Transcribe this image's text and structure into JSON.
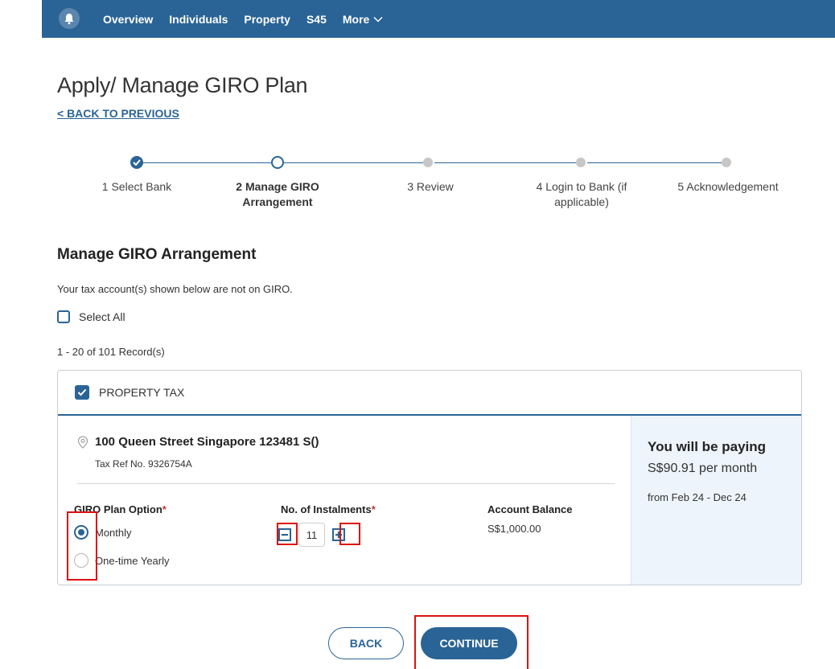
{
  "nav": {
    "items": [
      "Overview",
      "Individuals",
      "Property",
      "S45"
    ],
    "more_label": "More"
  },
  "page": {
    "title": "Apply/ Manage GIRO Plan",
    "back_link": "< BACK TO PREVIOUS"
  },
  "steps": [
    {
      "label": "1 Select Bank",
      "state": "done"
    },
    {
      "label": "2 Manage GIRO Arrangement",
      "state": "active"
    },
    {
      "label": "3 Review",
      "state": "pending"
    },
    {
      "label": "4 Login to Bank (if applicable)",
      "state": "pending"
    },
    {
      "label": "5 Acknowledgement",
      "state": "pending"
    }
  ],
  "section": {
    "title": "Manage GIRO Arrangement",
    "info": "Your tax account(s) shown below are not on GIRO.",
    "select_all_label": "Select All",
    "select_all_checked": false,
    "record_count": "1 - 20 of 101 Record(s)"
  },
  "card": {
    "header_label": "PROPERTY TAX",
    "header_checked": true,
    "address": "100 Queen Street Singapore 123481 S()",
    "tax_ref": "Tax Ref No. 9326754A",
    "plan_option_label": "GIRO Plan Option",
    "plan_options": [
      {
        "label": "Monthly",
        "selected": true
      },
      {
        "label": "One-time Yearly",
        "selected": false
      }
    ],
    "instalments_label": "No. of Instalments",
    "instalments_value": "11",
    "balance_label": "Account Balance",
    "balance_value": "S$1,000.00",
    "required_mark": "*",
    "summary": {
      "title": "You will be paying",
      "amount": "S$90.91 per month",
      "range": "from Feb 24 - Dec 24"
    }
  },
  "buttons": {
    "back": "BACK",
    "continue": "CONTINUE"
  },
  "colors": {
    "primary": "#2a6496",
    "highlight": "#dd1111",
    "panel_bg": "#eef4fb"
  }
}
